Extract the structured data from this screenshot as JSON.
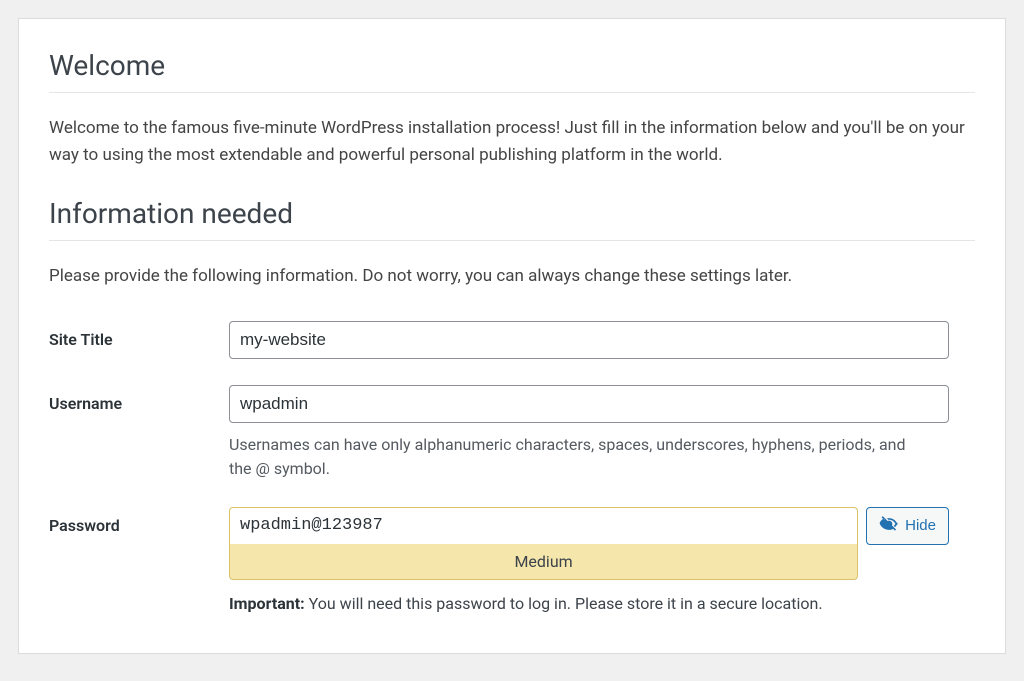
{
  "headings": {
    "welcome": "Welcome",
    "info_needed": "Information needed"
  },
  "copy": {
    "welcome_intro": "Welcome to the famous five-minute WordPress installation process! Just fill in the information below and you'll be on your way to using the most extendable and powerful personal publishing platform in the world.",
    "info_note": "Please provide the following information. Do not worry, you can always change these settings later."
  },
  "labels": {
    "site_title": "Site Title",
    "username": "Username",
    "password": "Password"
  },
  "fields": {
    "site_title": "my-website",
    "username": "wpadmin",
    "password": "wpadmin@123987"
  },
  "hints": {
    "username": "Usernames can have only alphanumeric characters, spaces, underscores, hyphens, periods, and the @ symbol.",
    "password_important_label": "Important:",
    "password_important_text": " You will need this password to log in. Please store it in a secure location."
  },
  "password": {
    "strength": "Medium",
    "hide_button": "Hide"
  }
}
